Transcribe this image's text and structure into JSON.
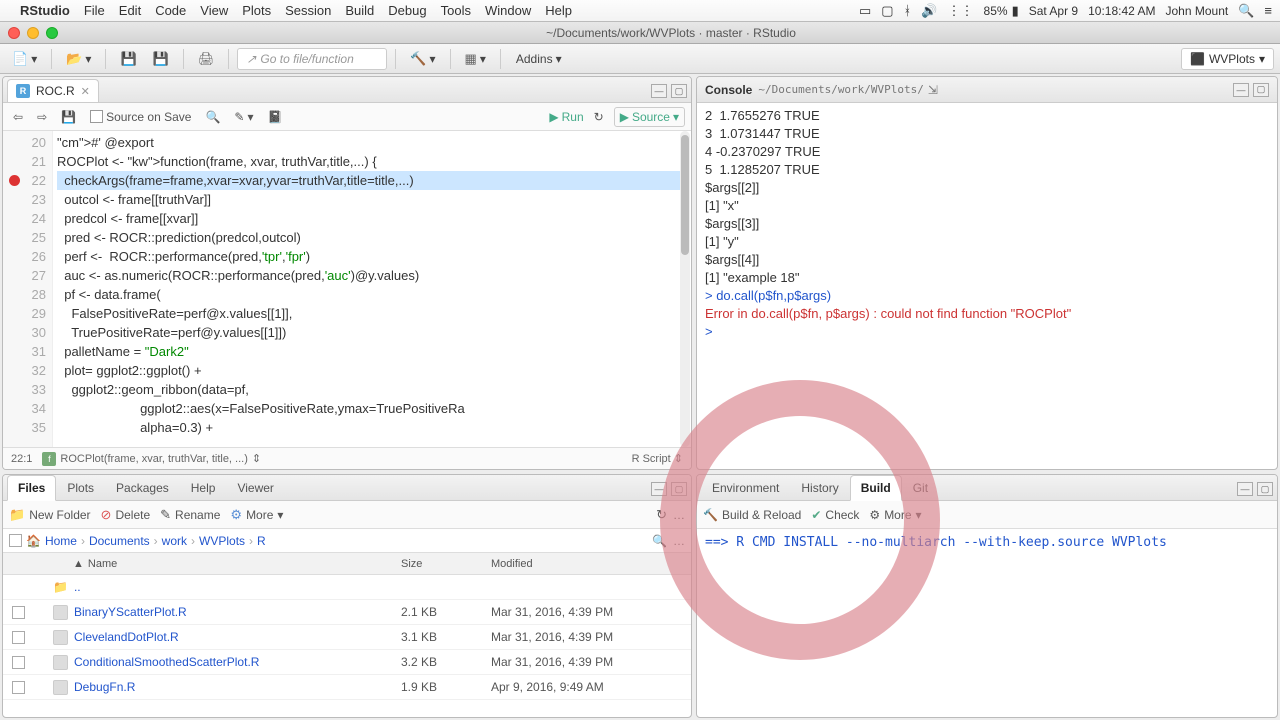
{
  "menubar": {
    "apple": "",
    "appname": "RStudio",
    "items": [
      "File",
      "Edit",
      "Code",
      "View",
      "Plots",
      "Session",
      "Build",
      "Debug",
      "Tools",
      "Window",
      "Help"
    ],
    "battery_pct": "85%",
    "date": "Sat Apr 9",
    "time": "10:18:42 AM",
    "user": "John Mount"
  },
  "window": {
    "title": "~/Documents/work/WVPlots · master · RStudio"
  },
  "maintb": {
    "goto_placeholder": "Go to file/function",
    "addins": "Addins",
    "project": "WVPlots"
  },
  "editor": {
    "tab_name": "ROC.R",
    "source_on_save": "Source on Save",
    "run": "Run",
    "source": "Source",
    "line_start": 20,
    "breakpoint_line": 22,
    "lines": [
      "#' @export",
      "ROCPlot <- function(frame, xvar, truthVar,title,...) {",
      "  checkArgs(frame=frame,xvar=xvar,yvar=truthVar,title=title,...)",
      "  outcol <- frame[[truthVar]]",
      "  predcol <- frame[[xvar]]",
      "  pred <- ROCR::prediction(predcol,outcol)",
      "  perf <-  ROCR::performance(pred,'tpr','fpr')",
      "  auc <- as.numeric(ROCR::performance(pred,'auc')@y.values)",
      "  pf <- data.frame(",
      "    FalsePositiveRate=perf@x.values[[1]],",
      "    TruePositiveRate=perf@y.values[[1]])",
      "  palletName = \"Dark2\"",
      "  plot= ggplot2::ggplot() +",
      "    ggplot2::geom_ribbon(data=pf,",
      "                       ggplot2::aes(x=FalsePositiveRate,ymax=TruePositiveRa",
      "                       alpha=0.3) +"
    ],
    "highlighted_index": 2,
    "status_pos": "22:1",
    "status_fn": "ROCPlot(frame, xvar, truthVar, title, ...)",
    "lang": "R Script"
  },
  "console": {
    "title": "Console",
    "path": "~/Documents/work/WVPlots/",
    "lines": [
      {
        "t": "out",
        "v": "2  1.7655276 TRUE"
      },
      {
        "t": "out",
        "v": "3  1.0731447 TRUE"
      },
      {
        "t": "out",
        "v": "4 -0.2370297 TRUE"
      },
      {
        "t": "out",
        "v": "5  1.1285207 TRUE"
      },
      {
        "t": "out",
        "v": ""
      },
      {
        "t": "out",
        "v": "$args[[2]]"
      },
      {
        "t": "out",
        "v": "[1] \"x\""
      },
      {
        "t": "out",
        "v": ""
      },
      {
        "t": "out",
        "v": "$args[[3]]"
      },
      {
        "t": "out",
        "v": "[1] \"y\""
      },
      {
        "t": "out",
        "v": ""
      },
      {
        "t": "out",
        "v": "$args[[4]]"
      },
      {
        "t": "out",
        "v": "[1] \"example 18\""
      },
      {
        "t": "out",
        "v": ""
      },
      {
        "t": "in",
        "v": "> do.call(p$fn,p$args)"
      },
      {
        "t": "err",
        "v": "Error in do.call(p$fn, p$args) : could not find function \"ROCPlot\""
      },
      {
        "t": "in",
        "v": "> "
      }
    ]
  },
  "files": {
    "tabs": [
      "Files",
      "Plots",
      "Packages",
      "Help",
      "Viewer"
    ],
    "active_tab": 0,
    "new_folder": "New Folder",
    "delete": "Delete",
    "rename": "Rename",
    "more": "More",
    "crumbs": [
      "Home",
      "Documents",
      "work",
      "WVPlots",
      "R"
    ],
    "cols": {
      "name": "Name",
      "size": "Size",
      "modified": "Modified"
    },
    "up": "..",
    "rows": [
      {
        "name": "BinaryYScatterPlot.R",
        "size": "2.1 KB",
        "mod": "Mar 31, 2016, 4:39 PM"
      },
      {
        "name": "ClevelandDotPlot.R",
        "size": "3.1 KB",
        "mod": "Mar 31, 2016, 4:39 PM"
      },
      {
        "name": "ConditionalSmoothedScatterPlot.R",
        "size": "3.2 KB",
        "mod": "Mar 31, 2016, 4:39 PM"
      },
      {
        "name": "DebugFn.R",
        "size": "1.9 KB",
        "mod": "Apr 9, 2016, 9:49 AM"
      }
    ]
  },
  "build": {
    "tabs": [
      "Environment",
      "History",
      "Build",
      "Git"
    ],
    "active_tab": 2,
    "build_reload": "Build & Reload",
    "check": "Check",
    "more": "More",
    "output": "==> R CMD INSTALL --no-multiarch --with-keep.source WVPlots"
  }
}
